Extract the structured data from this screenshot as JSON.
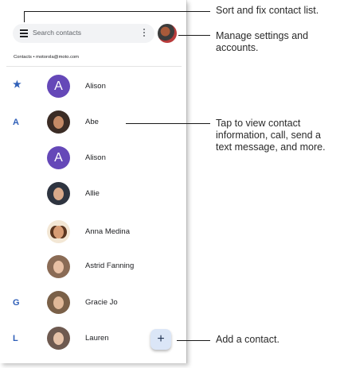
{
  "search": {
    "placeholder": "Search contacts"
  },
  "account": {
    "label": "Contacts • motorola@moto.com"
  },
  "contacts": [
    {
      "index": "★",
      "initial": "A",
      "name": "Alison"
    },
    {
      "index": "A",
      "initial": "",
      "name": "Abe"
    },
    {
      "index": "",
      "initial": "A",
      "name": "Alison"
    },
    {
      "index": "",
      "initial": "",
      "name": "Allie"
    },
    {
      "index": "",
      "initial": "",
      "name": "Anna Medina"
    },
    {
      "index": "",
      "initial": "",
      "name": "Astrid Fanning"
    },
    {
      "index": "G",
      "initial": "",
      "name": "Gracie Jo"
    },
    {
      "index": "L",
      "initial": "",
      "name": "Lauren"
    }
  ],
  "fab": {
    "label": "+"
  },
  "callouts": {
    "sort": "Sort and fix contact list.",
    "settings": "Manage settings and accounts.",
    "tap": "Tap to view contact information, call, send a text message, and more.",
    "add": "Add a contact."
  },
  "icons": {
    "menu": "menu-icon",
    "more": "more-vert-icon",
    "favorite": "star-icon",
    "add": "plus-icon"
  },
  "colors": {
    "accent": "#2f5fb8",
    "avatar_initial_bg": "#6548b8",
    "search_bg": "#f2f3f5",
    "fab_bg": "#dbe6f7"
  }
}
